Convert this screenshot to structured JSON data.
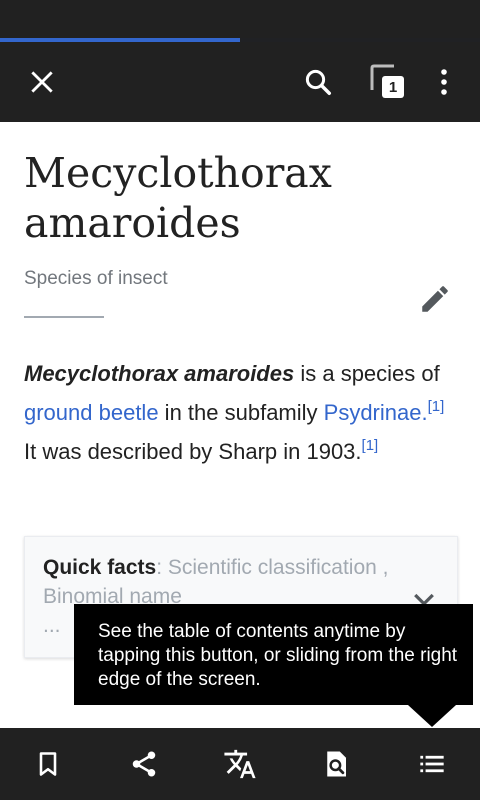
{
  "status_bar": {},
  "page_load_progress": 0.5,
  "toolbar": {
    "tab_count": "1",
    "icons": [
      "close-icon",
      "search-icon",
      "tabs-icon",
      "more-vert-icon"
    ]
  },
  "article": {
    "title_line1": "Mecyclothorax",
    "title_line2": "amaroides",
    "description": "Species of insect",
    "lead": {
      "bold_name": "Mecyclothorax amaroides",
      "text1": " is a species of ",
      "link1": "ground beetle",
      "text2": " in the subfamily ",
      "link2": "Psydrinae",
      "text3": ".",
      "ref1": "[1]",
      "text4": " It was described by Sharp in 1903.",
      "ref2": "[1]"
    }
  },
  "quick_facts": {
    "label": "Quick facts",
    "summary": ": Scientific classification , Binomial name",
    "ellipsis": "..."
  },
  "tooltip": {
    "text": "See the table of contents anytime by tapping this button, or sliding from the right edge of the screen."
  },
  "bottom_bar": {
    "icons": [
      "bookmark-icon",
      "share-icon",
      "translate-icon",
      "find-in-page-icon",
      "table-of-contents-icon"
    ]
  },
  "colors": {
    "bars": "#212121",
    "link": "#3366cc",
    "progress": "#3366cc"
  }
}
